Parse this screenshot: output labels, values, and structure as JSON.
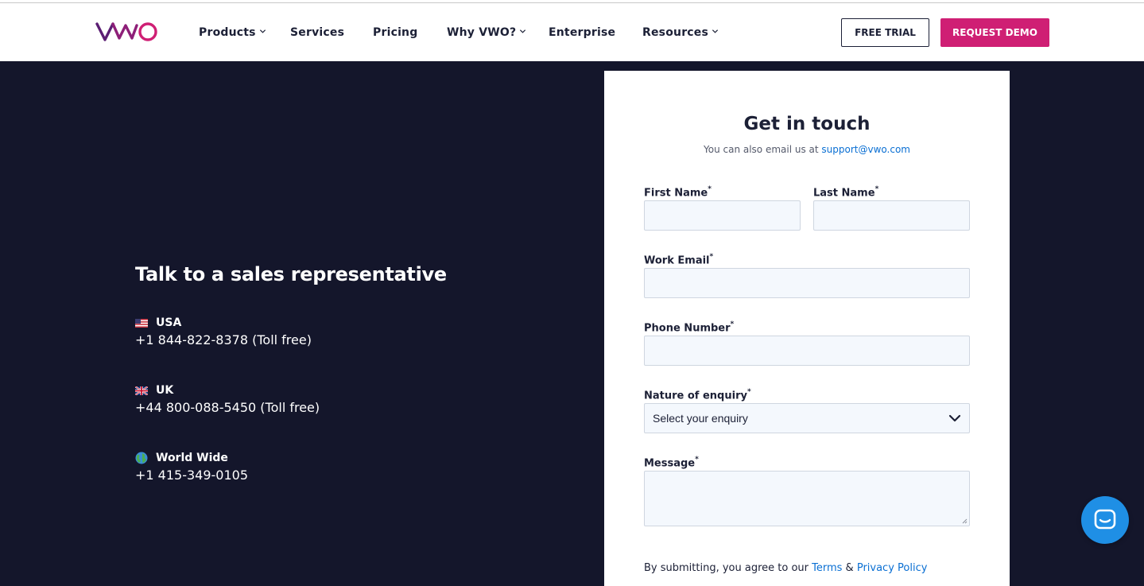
{
  "colors": {
    "brand_pink": "#cf1f74",
    "dark_navy": "#14162b",
    "text_dark": "#1c2036",
    "link_blue": "#0a6fd3",
    "chat_blue": "#1f8fe5",
    "field_bg": "#f4f8fd"
  },
  "header": {
    "logo_alt": "VWO",
    "nav": [
      {
        "label": "Products",
        "has_dropdown": true
      },
      {
        "label": "Services",
        "has_dropdown": false
      },
      {
        "label": "Pricing",
        "has_dropdown": false
      },
      {
        "label": "Why VWO?",
        "has_dropdown": true
      },
      {
        "label": "Enterprise",
        "has_dropdown": false
      },
      {
        "label": "Resources",
        "has_dropdown": true
      }
    ],
    "free_trial_label": "FREE TRIAL",
    "request_demo_label": "REQUEST DEMO"
  },
  "sales": {
    "heading": "Talk to a sales representative",
    "regions": [
      {
        "name": "USA",
        "phone": "+1 844-822-8378 (Toll free)",
        "icon": "us-flag-icon"
      },
      {
        "name": "UK",
        "phone": "+44 800-088-5450 (Toll free)",
        "icon": "uk-flag-icon"
      },
      {
        "name": "World Wide",
        "phone": "+1 415-349-0105",
        "icon": "globe-icon"
      }
    ]
  },
  "form": {
    "title": "Get in touch",
    "subtitle_prefix": "You can also email us at ",
    "support_email": "support@vwo.com",
    "required_mark": "*",
    "first_name_label": "First Name",
    "last_name_label": "Last Name",
    "work_email_label": "Work Email",
    "phone_label": "Phone Number",
    "enquiry_label": "Nature of enquiry",
    "enquiry_selected": "Select your enquiry",
    "message_label": "Message",
    "consent_prefix": "By submitting, you agree to our ",
    "terms_label": "Terms",
    "consent_and": " & ",
    "privacy_label": "Privacy Policy"
  },
  "chat": {
    "icon": "chat-icon"
  }
}
